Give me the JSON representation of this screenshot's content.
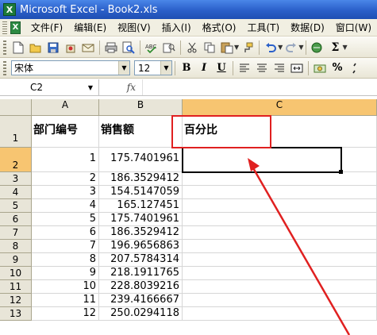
{
  "window": {
    "title": "Microsoft Excel - Book2.xls"
  },
  "menu": {
    "items": [
      "文件(F)",
      "编辑(E)",
      "视图(V)",
      "插入(I)",
      "格式(O)",
      "工具(T)",
      "数据(D)",
      "窗口(W)"
    ]
  },
  "toolbar": {
    "font_name": "宋体",
    "font_size": "12",
    "bold_label": "B",
    "italic_label": "I",
    "underline_label": "U",
    "percent_label": "%"
  },
  "formula_bar": {
    "name_box": "C2",
    "fx_label": "fx",
    "content": ""
  },
  "sheet": {
    "columns": [
      "A",
      "B",
      "C"
    ],
    "active_column": "C",
    "active_row": "2",
    "header_row": {
      "row": "1",
      "a": "部门编号",
      "b": "销售额",
      "c": "百分比"
    },
    "rows": [
      {
        "row": "2",
        "a": "1",
        "b": "175.7401961"
      },
      {
        "row": "3",
        "a": "2",
        "b": "186.3529412"
      },
      {
        "row": "4",
        "a": "3",
        "b": "154.5147059"
      },
      {
        "row": "5",
        "a": "4",
        "b": "165.127451"
      },
      {
        "row": "6",
        "a": "5",
        "b": "175.7401961"
      },
      {
        "row": "7",
        "a": "6",
        "b": "186.3529412"
      },
      {
        "row": "8",
        "a": "7",
        "b": "196.9656863"
      },
      {
        "row": "9",
        "a": "8",
        "b": "207.5784314"
      },
      {
        "row": "10",
        "a": "9",
        "b": "218.1911765"
      },
      {
        "row": "11",
        "a": "10",
        "b": "228.8039216"
      },
      {
        "row": "12",
        "a": "11",
        "b": "239.4166667"
      },
      {
        "row": "13",
        "a": "12",
        "b": "250.0294118"
      }
    ]
  },
  "annotation": {
    "color": "#e02020"
  }
}
